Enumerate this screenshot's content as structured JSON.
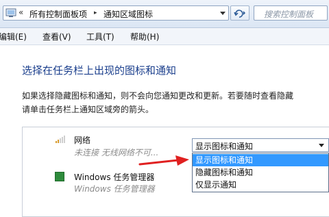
{
  "address_bar": {
    "back_symbol": "«",
    "crumbs": [
      "所有控制面板项",
      "通知区域图标"
    ],
    "separator": "▸",
    "search_placeholder": "搜索控制面板"
  },
  "menu": [
    "编辑(E)",
    "查看(V)",
    "工具(T)",
    "帮助(H)"
  ],
  "page": {
    "title": "选择在任务栏上出现的图标和通知",
    "description_line1": "如果选择隐藏图标和通知，则不会向您通知更改和更新。若要随时查看隐藏",
    "description_line2": "请单击任务栏上通知区域旁的箭头。"
  },
  "items": [
    {
      "name": "网络",
      "subtitle": "未连接 无线网络不可...",
      "icon": "network-signal-icon"
    },
    {
      "name": "Windows 任务管理器",
      "subtitle": "Windows 任务管理器",
      "icon": "task-manager-icon"
    }
  ],
  "behavior_combo": {
    "selected": "显示图标和通知",
    "options": [
      "显示图标和通知",
      "隐藏图标和通知",
      "仅显示通知"
    ],
    "highlighted_index": 0
  },
  "colors": {
    "title": "#1a3e8c",
    "highlight": "#3399ff",
    "arrow": "#e02020"
  }
}
